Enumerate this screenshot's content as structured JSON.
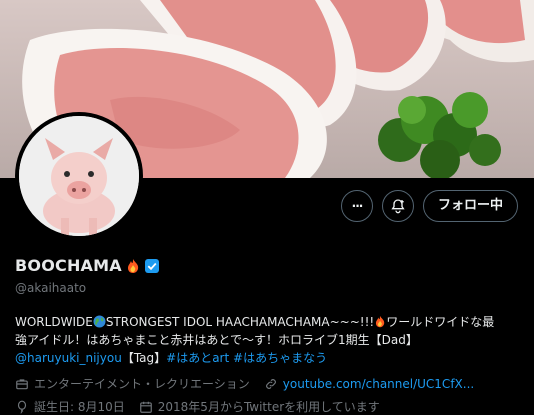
{
  "profile": {
    "name": "BOOCHAMA",
    "handle": "@akaihaato",
    "bio": {
      "line1_text": "WORLDWIDE",
      "line1_text2": "STRONGEST IDOL HAACHAMACHAMA~~~!!!",
      "line1_text3": "ワールドワイドな最",
      "line2_text": "強アイドル！はあちゃまこと赤井はあとで〜す！ホロライブ1期生【Dad】",
      "mention": "@haruyuki_nijyou",
      "tag_text": "【Tag】",
      "hashtag1": "#はあとart",
      "hashtag2": "#はあちゃまなう"
    },
    "category": "エンターテイメント・レクリエーション",
    "website": "youtube.com/channel/UC1CfX...",
    "birthday": "誕生日: 8月10日",
    "joined": "2018年5月からTwitterを利用しています"
  },
  "actions": {
    "more_label": "···",
    "follow_label": "フォロー中"
  },
  "colors": {
    "accent": "#1d9bf0",
    "muted": "#71767b",
    "background": "#000000",
    "verified": "#1d9bf0"
  },
  "icons": {
    "more": "more-icon",
    "notifications": "bell-plus-icon",
    "category": "briefcase-icon",
    "website": "link-icon",
    "birthday": "balloon-icon",
    "joined": "calendar-icon",
    "verified": "verified-badge-icon",
    "fire": "fire-emoji",
    "globe": "globe-emoji"
  }
}
